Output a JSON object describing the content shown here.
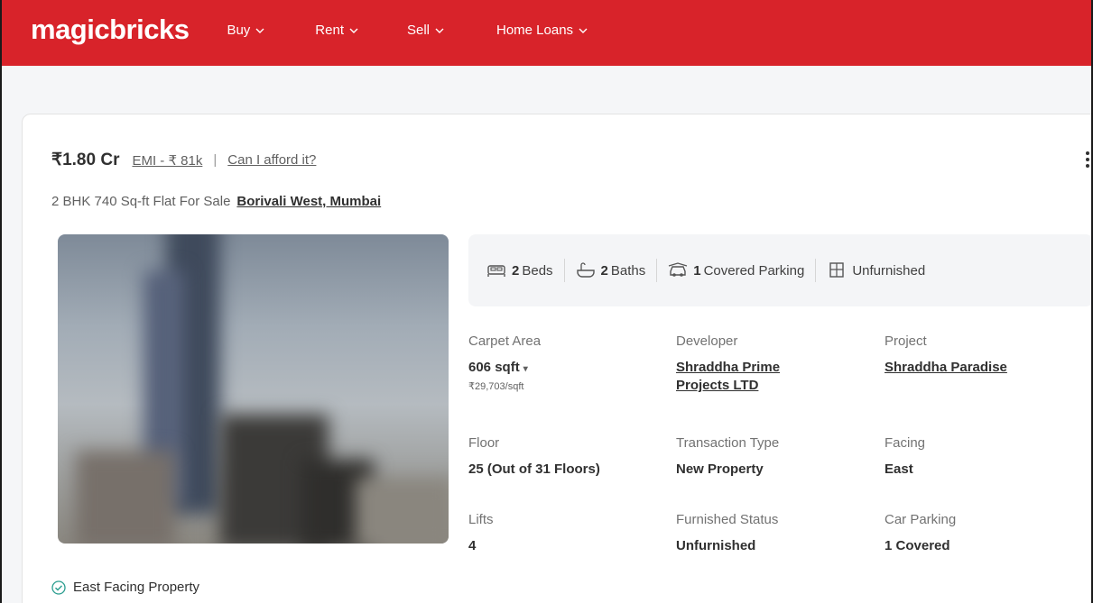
{
  "brand": {
    "logo_text": "magicbricks",
    "accent": "#d8232a"
  },
  "nav": {
    "buy": "Buy",
    "rent": "Rent",
    "sell": "Sell",
    "home_loans": "Home Loans"
  },
  "listing": {
    "price": "₹1.80 Cr",
    "emi": "EMI - ₹ 81k",
    "afford": "Can I afford it?",
    "title": "2 BHK 740 Sq-ft Flat For Sale",
    "location": "Borivali West, Mumbai",
    "amenities": {
      "beds_count": "2",
      "beds_label": "Beds",
      "baths_count": "2",
      "baths_label": "Baths",
      "parking_count": "1",
      "parking_label": "Covered Parking",
      "furnishing": "Unfurnished"
    },
    "specs": {
      "carpet_area_label": "Carpet Area",
      "carpet_area_value": "606 sqft",
      "carpet_area_rate": "₹29,703/sqft",
      "developer_label": "Developer",
      "developer_value": "Shraddha Prime Projects LTD",
      "project_label": "Project",
      "project_value": "Shraddha Paradise",
      "floor_label": "Floor",
      "floor_value": "25 (Out of 31 Floors)",
      "transaction_label": "Transaction Type",
      "transaction_value": "New Property",
      "facing_label": "Facing",
      "facing_value": "East",
      "lifts_label": "Lifts",
      "lifts_value": "4",
      "furnished_label": "Furnished Status",
      "furnished_value": "Unfurnished",
      "car_parking_label": "Car Parking",
      "car_parking_value": "1 Covered"
    },
    "highlight": "East Facing Property"
  }
}
